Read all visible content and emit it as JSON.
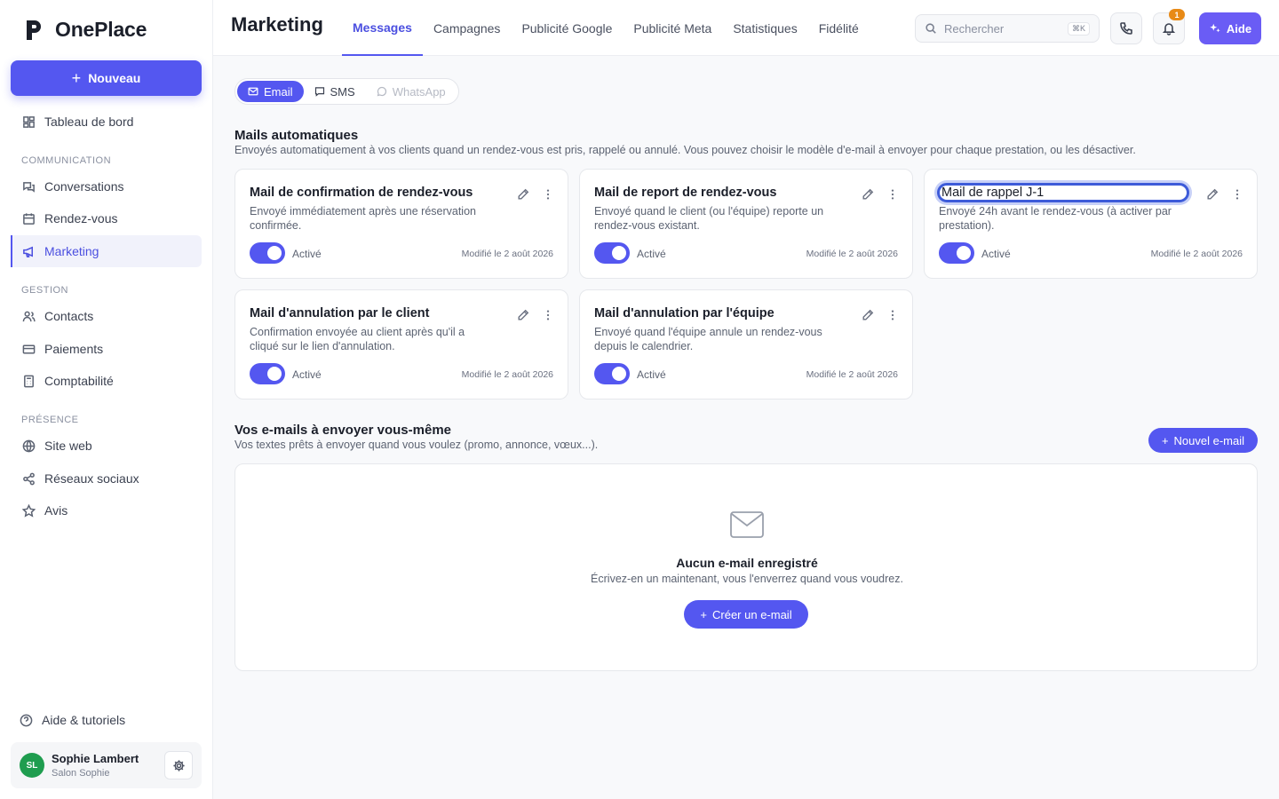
{
  "app": {
    "name": "OnePlace"
  },
  "sidebar": {
    "new_button": "Nouveau",
    "dashboard": "Tableau de bord",
    "sections": [
      {
        "label": "COMMUNICATION",
        "items": [
          "Conversations",
          "Rendez-vous",
          "Marketing"
        ]
      },
      {
        "label": "GESTION",
        "items": [
          "Contacts",
          "Paiements",
          "Comptabilité"
        ]
      },
      {
        "label": "PRÉSENCE",
        "items": [
          "Site web",
          "Réseaux sociaux",
          "Avis"
        ]
      }
    ],
    "active_item": "Marketing",
    "help": "Aide & tutoriels",
    "user": {
      "initials": "SL",
      "name": "Sophie Lambert",
      "subtitle": "Salon Sophie",
      "avatar_color": "#1f9d4f"
    }
  },
  "header": {
    "title": "Marketing",
    "tabs": [
      "Messages",
      "Campagnes",
      "Publicité Google",
      "Publicité Meta",
      "Statistiques",
      "Fidélité"
    ],
    "active_tab": "Messages",
    "search": {
      "placeholder": "Rechercher",
      "shortcut": "⌘K"
    },
    "notifications_count": "1",
    "help_button": "Aide"
  },
  "channels": {
    "items": [
      "Email",
      "SMS",
      "WhatsApp"
    ],
    "active": "Email",
    "disabled": "WhatsApp"
  },
  "auto_mails": {
    "title": "Mails automatiques",
    "description": "Envoyés automatiquement à vos clients quand un rendez-vous est pris, rappelé ou annulé. Vous pouvez choisir le modèle d'e-mail à envoyer pour chaque prestation, ou les désactiver.",
    "cards": [
      {
        "title": "Mail de confirmation de rendez-vous",
        "description": "Envoyé immédiatement après une réservation confirmée.",
        "status": "Activé",
        "enabled": true,
        "modified": "Modifié le 2 août 2026"
      },
      {
        "title": "Mail de report de rendez-vous",
        "description": "Envoyé quand le client (ou l'équipe) reporte un rendez-vous existant.",
        "status": "Activé",
        "enabled": true,
        "modified": "Modifié le 2 août 2026"
      },
      {
        "title": "Mail de rappel J-1",
        "description": "Envoyé 24h avant le rendez-vous (à activer par prestation).",
        "status": "Activé",
        "enabled": true,
        "modified": "Modifié le 2 août 2026",
        "editing": true
      },
      {
        "title": "Mail d'annulation par le client",
        "description": "Confirmation envoyée au client après qu'il a cliqué sur le lien d'annulation.",
        "status": "Activé",
        "enabled": true,
        "modified": "Modifié le 2 août 2026"
      },
      {
        "title": "Mail d'annulation par l'équipe",
        "description": "Envoyé quand l'équipe annule un rendez-vous depuis le calendrier.",
        "status": "Activé",
        "enabled": true,
        "modified": "Modifié le 2 août 2026"
      }
    ]
  },
  "custom_mails": {
    "title": "Vos e-mails à envoyer vous-même",
    "description": "Vos textes prêts à envoyer quand vous voulez (promo, annonce, vœux...).",
    "new_button": "Nouvel e-mail",
    "empty_title": "Aucun e-mail enregistré",
    "empty_description": "Écrivez-en un maintenant, vous l'enverrez quand vous voudrez.",
    "create_button": "Créer un e-mail"
  },
  "colors": {
    "accent": "#5457f0",
    "help_button": "#6a5cf5",
    "badge": "#e88a16"
  }
}
